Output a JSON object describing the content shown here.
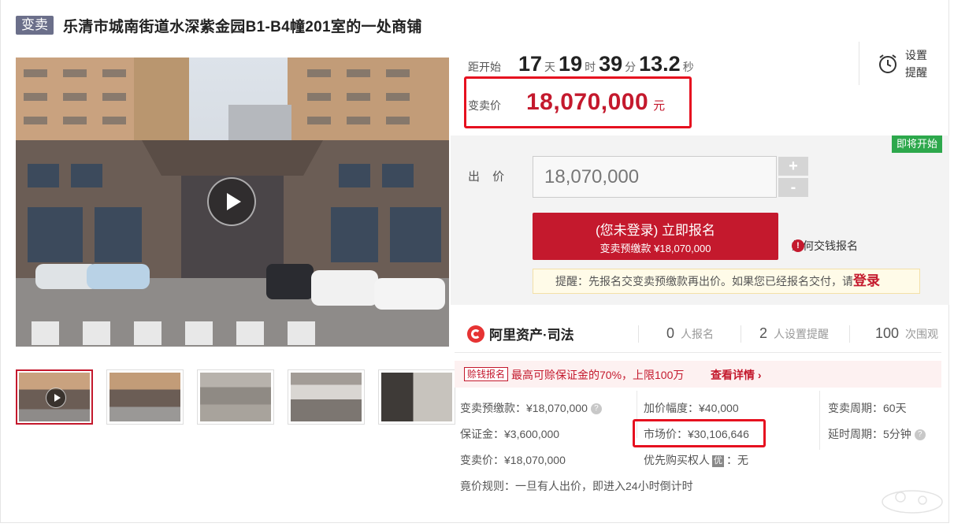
{
  "header": {
    "tag": "变卖",
    "title": "乐清市城南街道水深紫金园B1-B4幢201室的一处商铺"
  },
  "countdown": {
    "label": "距开始",
    "days": "17",
    "days_unit": "天",
    "hours": "19",
    "hours_unit": "时",
    "minutes": "39",
    "minutes_unit": "分",
    "seconds": "13.2",
    "seconds_unit": "秒"
  },
  "reminder": {
    "line1": "设置",
    "line2": "提醒"
  },
  "price": {
    "label": "变卖价",
    "value": "18,070,000",
    "unit": "元"
  },
  "bid": {
    "status_badge": "即将开始",
    "label": "出 价",
    "input_value": "18,070,000",
    "plus": "+",
    "minus": "-",
    "signup_main": "(您未登录) 立即报名",
    "signup_sub": "变卖预缴款 ¥18,070,000",
    "how_link": "如何交钱报名",
    "notice_text": "提醒：先报名交变卖预缴款再出价。如果您已经报名交付，请",
    "notice_login": "登录"
  },
  "brand": {
    "name": "阿里资产·司法"
  },
  "stats": [
    {
      "num": "0",
      "label": "人报名"
    },
    {
      "num": "2",
      "label": "人设置提醒"
    },
    {
      "num": "100",
      "label": "次围观"
    }
  ],
  "promo": {
    "tag": "赊钱报名",
    "text": "最高可赊保证金的70%，上限100万",
    "link": "查看详情 ›"
  },
  "details": {
    "deposit_prepay": "变卖预缴款：¥18,070,000",
    "increment": "加价幅度：¥40,000",
    "period": "变卖周期：60天",
    "bond": "保证金：¥3,600,000",
    "market_price": "市场价：¥30,106,646",
    "delay_period": "延时周期：5分钟",
    "sale_price": "变卖价：¥18,070,000",
    "priority_label": "优先购买权人",
    "priority_badge": "优",
    "priority_value": "：无",
    "rule": "竟价规则：一旦有人出价，即进入24小时倒计时"
  },
  "colors": {
    "accent_red": "#c4192d",
    "highlight_box": "#e6101f",
    "green_badge": "#2da84c",
    "tag_bg": "#6b6f8a"
  },
  "icons": [
    "play-icon",
    "alarm-clock-icon",
    "info-icon",
    "help-icon",
    "plus-icon",
    "minus-icon",
    "ali-logo-icon"
  ]
}
